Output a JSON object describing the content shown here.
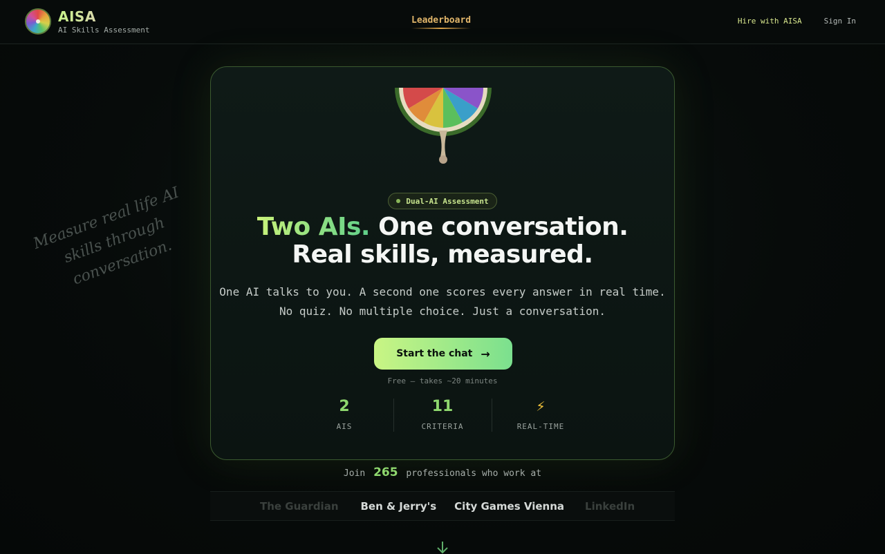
{
  "header": {
    "brand_title": "AISA",
    "brand_subtitle": "AI Skills Assessment",
    "nav_leaderboard": "Leaderboard",
    "nav_hire": "Hire with AISA",
    "nav_signin": "Sign In"
  },
  "side_note": {
    "line1": "Measure real life AI",
    "line2": "skills through",
    "line3": "conversation."
  },
  "hero": {
    "badge": "Dual-AI Assessment",
    "headline_accent": "Two AIs.",
    "headline_rest": " One conversation.",
    "headline_line2": "Real skills, measured.",
    "sub_line1": "One AI talks to you. A second one scores every answer in real time.",
    "sub_line2": "No quiz. No multiple choice. Just a conversation.",
    "cta_label": "Start the chat",
    "free_note": "Free — takes ~20 minutes"
  },
  "stats": [
    {
      "value": "2",
      "label": "AIS"
    },
    {
      "value": "11",
      "label": "CRITERIA"
    },
    {
      "icon": "lightning-icon",
      "label": "REAL-TIME"
    }
  ],
  "join": {
    "prefix": "Join",
    "count": "265",
    "suffix": "professionals who work at"
  },
  "companies": [
    "The Guardian",
    "Ben & Jerry's",
    "City Games Vienna",
    "LinkedIn"
  ],
  "colors": {
    "accent_green": "#8fd86e",
    "accent_gold": "#e0b56a",
    "card_border": "#3b5a30",
    "background": "#070b0a"
  }
}
